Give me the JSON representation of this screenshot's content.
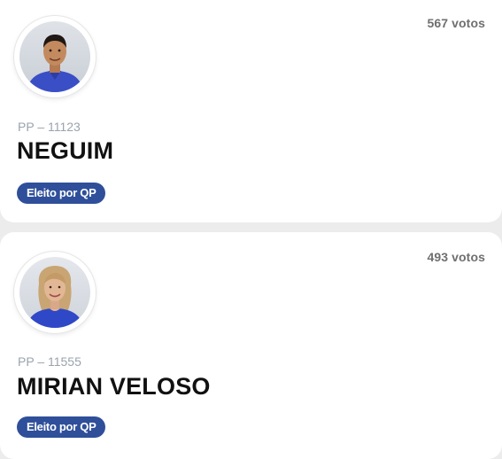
{
  "candidates": [
    {
      "votes": "567 votos",
      "party": "PP – 11123",
      "name": "NEGUIM",
      "badge": "Eleito por QP"
    },
    {
      "votes": "493 votos",
      "party": "PP – 11555",
      "name": "MIRIAN VELOSO",
      "badge": "Eleito por QP"
    }
  ],
  "colors": {
    "page_background": "#ececec",
    "card_background": "#ffffff",
    "badge_background": "#2f4f9a",
    "party_text": "#9aa3ad",
    "votes_text": "#6f6f6f"
  }
}
